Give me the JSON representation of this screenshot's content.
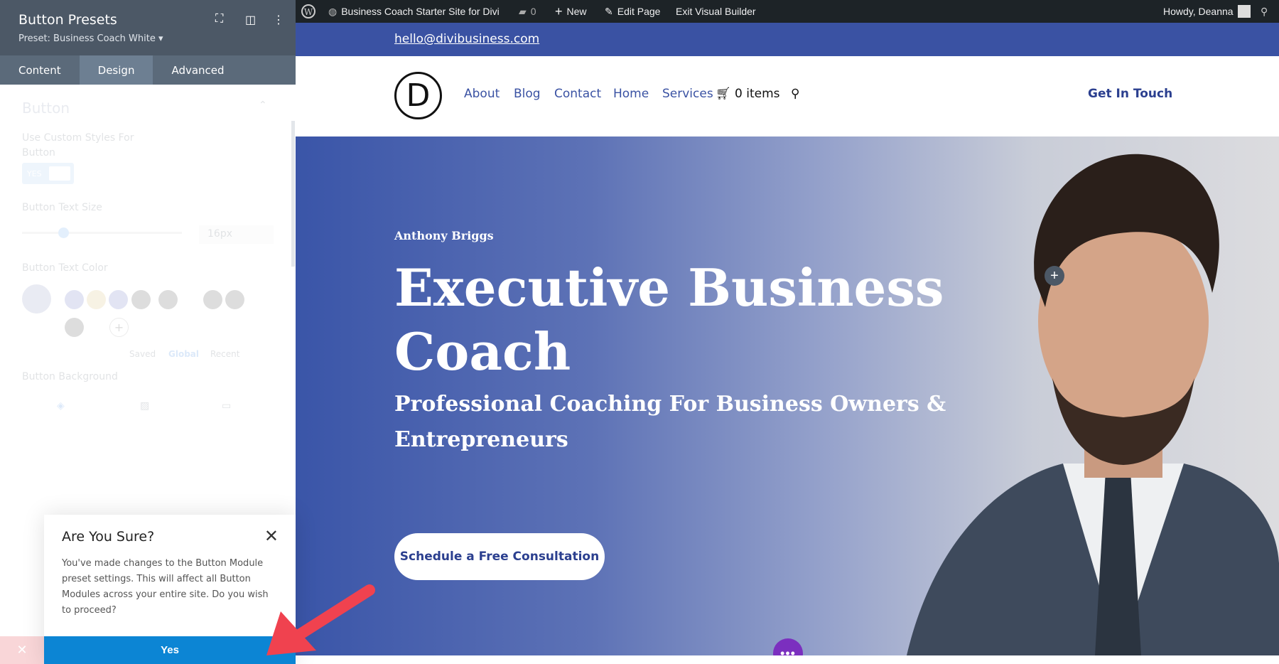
{
  "admin_bar": {
    "site_name": "Business Coach Starter Site for Divi",
    "comments": "0",
    "new": "New",
    "edit": "Edit Page",
    "exit": "Exit Visual Builder",
    "user": "Howdy, Deanna"
  },
  "panel": {
    "title": "Button Presets",
    "preset": "Preset: Business Coach White ▾",
    "tabs": [
      "Content",
      "Design",
      "Advanced"
    ],
    "active_tab": "Design",
    "section": "Button",
    "custom_styles_label": "Use Custom Styles For Button",
    "toggle": "YES",
    "text_size_label": "Button Text Size",
    "text_size_value": "16px",
    "text_size_fraction": 0.15,
    "text_color_label": "Button Text Color",
    "palette_tabs": [
      "Saved",
      "Global",
      "Recent"
    ],
    "background_label": "Button Background"
  },
  "dialog": {
    "title": "Are You Sure?",
    "body": "You've made changes to the Button Module preset settings. This will affect all Button Modules across your entire site. Do you wish to proceed?",
    "yes": "Yes"
  },
  "site": {
    "email": "hello@divibusiness.com",
    "logo": "D",
    "nav": [
      "About",
      "Blog",
      "Contact",
      "Home",
      "Services"
    ],
    "cart": "0 items",
    "cta_header": "Get In Touch",
    "hero": {
      "name": "Anthony Briggs",
      "headline_1": "Executive Business",
      "headline_2": "Coach",
      "sub_1": "Professional Coaching For Business Owners &",
      "sub_2": "Entrepreneurs",
      "button": "Schedule a Free Consultation"
    }
  },
  "colors": {
    "brand": "#3a52a3",
    "admin": "#1d2327",
    "confirm": "#0c85d4",
    "arrow": "#f0424f",
    "dots": "#7b2fbf"
  }
}
